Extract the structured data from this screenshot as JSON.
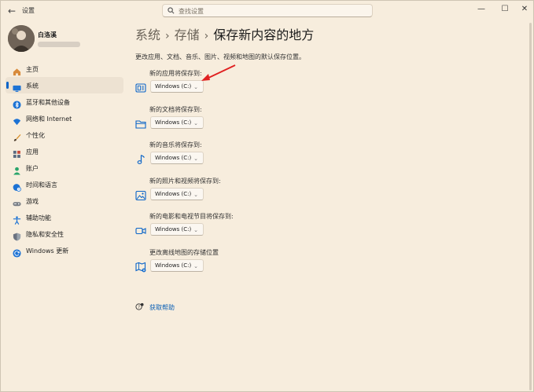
{
  "window": {
    "title": "设置",
    "search_placeholder": "查找设置",
    "controls": {
      "minimize": "—",
      "maximize": "☐",
      "close": "✕"
    }
  },
  "profile": {
    "name": "白洛溪"
  },
  "sidebar": {
    "items": [
      {
        "label": "主页",
        "icon": "home-icon",
        "color": "#d88a3a"
      },
      {
        "label": "系统",
        "icon": "monitor-icon",
        "color": "#1c72d4",
        "active": true
      },
      {
        "label": "蓝牙和其他设备",
        "icon": "bluetooth-icon",
        "color": "#1c72d4"
      },
      {
        "label": "网络和 Internet",
        "icon": "wifi-icon",
        "color": "#1c72d4"
      },
      {
        "label": "个性化",
        "icon": "brush-icon",
        "color": "#d9902c"
      },
      {
        "label": "应用",
        "icon": "apps-icon",
        "color": "#5a6b80"
      },
      {
        "label": "账户",
        "icon": "account-icon",
        "color": "#2aa56b"
      },
      {
        "label": "时间和语言",
        "icon": "globe-clock-icon",
        "color": "#1c72d4"
      },
      {
        "label": "游戏",
        "icon": "gamepad-icon",
        "color": "#7a7f86"
      },
      {
        "label": "辅助功能",
        "icon": "accessibility-icon",
        "color": "#1c72d4"
      },
      {
        "label": "隐私和安全性",
        "icon": "shield-icon",
        "color": "#6b7280"
      },
      {
        "label": "Windows 更新",
        "icon": "update-icon",
        "color": "#1c72d4"
      }
    ]
  },
  "breadcrumb": {
    "items": [
      "系统",
      "存储"
    ],
    "current": "保存新内容的地方"
  },
  "description": "更改应用、文档、音乐、图片、视频和地图的默认保存位置。",
  "sections": [
    {
      "label": "新的应用将保存到:",
      "value": "Windows (C:)",
      "icon": "app-window-icon"
    },
    {
      "label": "新的文档将保存到:",
      "value": "Windows (C:)",
      "icon": "folder-icon"
    },
    {
      "label": "新的音乐将保存到:",
      "value": "Windows (C:)",
      "icon": "music-note-icon"
    },
    {
      "label": "新的照片和视频将保存到:",
      "value": "Windows (C:)",
      "icon": "photo-icon"
    },
    {
      "label": "新的电影和电视节目将保存到:",
      "value": "Windows (C:)",
      "icon": "video-camera-icon"
    },
    {
      "label": "更改离线地图的存储位置",
      "value": "Windows (C:)",
      "icon": "map-icon"
    }
  ],
  "help": {
    "label": "获取帮助"
  },
  "accent_color": "#0a64c8",
  "annotation_color": "#e02020"
}
